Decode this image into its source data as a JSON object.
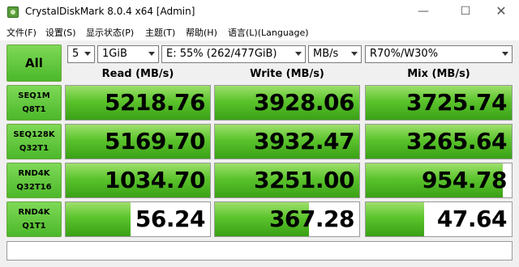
{
  "window": {
    "title": "CrystalDiskMark 8.0.4 x64 [Admin]",
    "min_glyph": "—",
    "max_glyph": "☐",
    "close_glyph": "✕"
  },
  "menu": [
    "文件(F)",
    "设置(S)",
    "显示状态(P)",
    "主题(T)",
    "帮助(H)",
    "语言(L)(Language)"
  ],
  "controls": {
    "all_label": "All",
    "count": "5",
    "size": "1GiB",
    "drive": "E: 55% (262/477GiB)",
    "unit": "MB/s",
    "profile": "R70%/W30%"
  },
  "columns": [
    "Read (MB/s)",
    "Write (MB/s)",
    "Mix (MB/s)"
  ],
  "rows": [
    {
      "label1": "SEQ1M",
      "label2": "Q8T1",
      "read": "5218.76",
      "write": "3928.06",
      "mix": "3725.74",
      "read_fill": 1.0,
      "write_fill": 1.0,
      "mix_fill": 1.0
    },
    {
      "label1": "SEQ128K",
      "label2": "Q32T1",
      "read": "5169.70",
      "write": "3932.47",
      "mix": "3265.64",
      "read_fill": 1.0,
      "write_fill": 1.0,
      "mix_fill": 1.0
    },
    {
      "label1": "RND4K",
      "label2": "Q32T16",
      "read": "1034.70",
      "write": "3251.00",
      "mix": "954.78",
      "read_fill": 1.0,
      "write_fill": 1.0,
      "mix_fill": 0.94
    },
    {
      "label1": "RND4K",
      "label2": "Q1T1",
      "read": "56.24",
      "write": "367.28",
      "mix": "47.64",
      "read_fill": 0.45,
      "write_fill": 0.65,
      "mix_fill": 0.4
    }
  ],
  "colors": {
    "accent_green": "#4cb82a",
    "bar_light": "#9ee06c",
    "bar_dark": "#3aa016"
  }
}
